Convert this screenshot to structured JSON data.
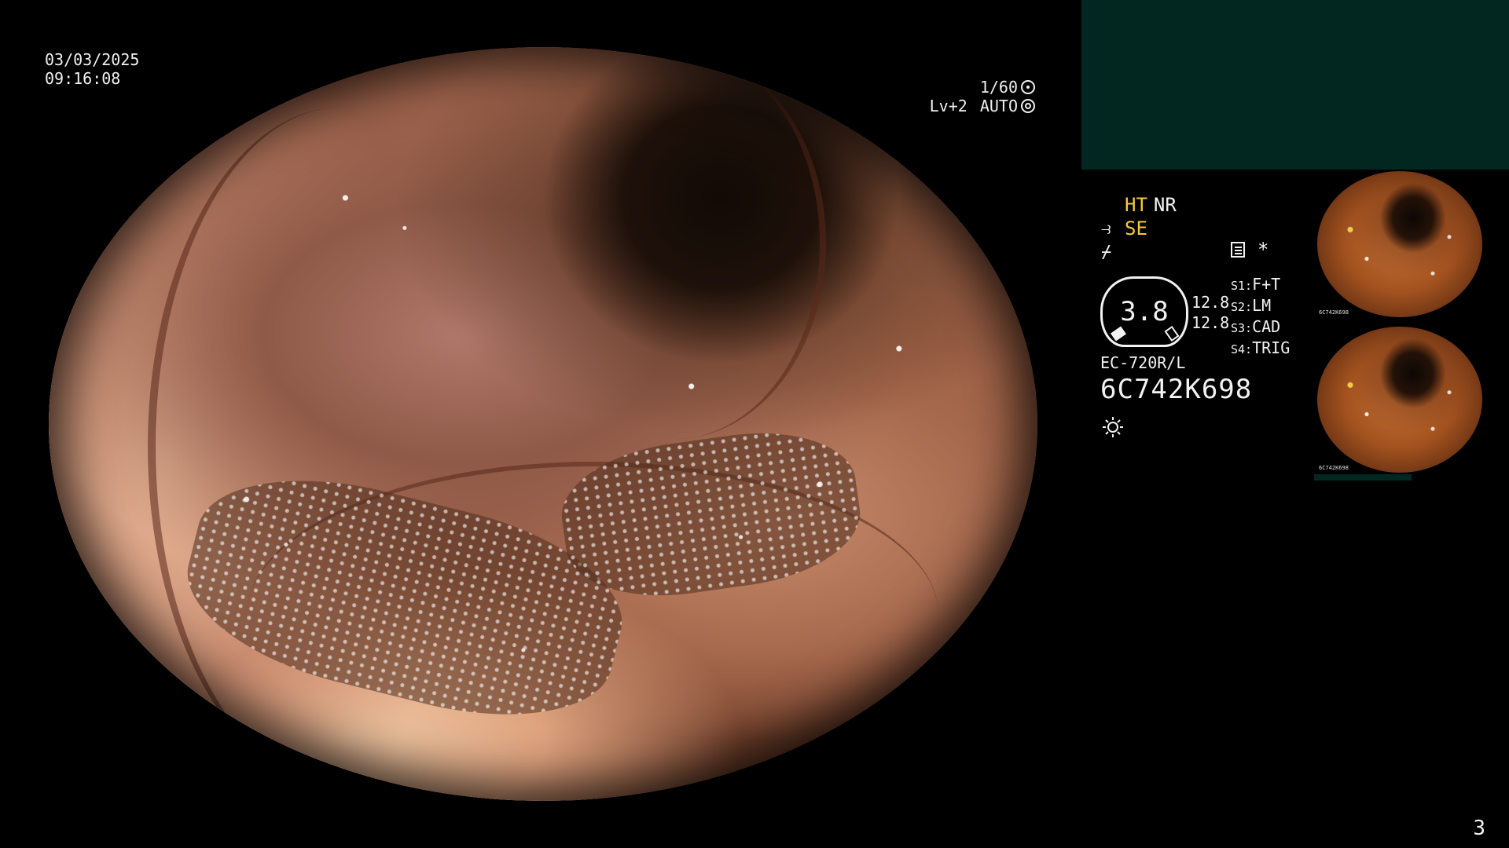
{
  "overlay": {
    "date": "03/03/2025",
    "time": "09:16:08",
    "shutter": "1/60",
    "level": "Lv+2",
    "mode": "AUTO"
  },
  "status": {
    "ht": "HT",
    "nr": "NR",
    "se": "SE",
    "dial_value": "3.8",
    "dial_num_1": "12.8",
    "dial_num_2": "12.8",
    "star": "*",
    "switches": [
      {
        "key": "S1:",
        "value": "F+T"
      },
      {
        "key": "S2:",
        "value": "LM"
      },
      {
        "key": "S3:",
        "value": "CAD"
      },
      {
        "key": "S4:",
        "value": "TRIG"
      }
    ],
    "model": "EC-720R/L",
    "serial": "6C742K698"
  },
  "thumbnails": [
    {
      "label": "6C742K698"
    },
    {
      "label": "6C742K698"
    }
  ],
  "page_number": "3",
  "colors": {
    "accent_yellow": "#f7c935",
    "panel_green": "#022720",
    "text": "#f2f2f2"
  },
  "icons": [
    "scope-ring-icon",
    "scope-mark-icon",
    "scope-link-icon",
    "cable-icon",
    "lamp-icon",
    "document-icon",
    "star-icon"
  ]
}
